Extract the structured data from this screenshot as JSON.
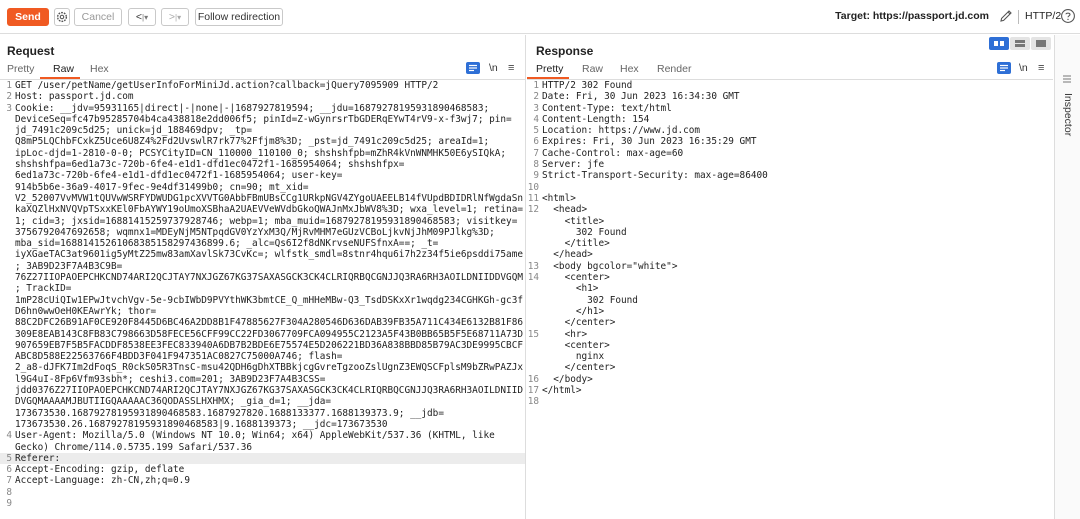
{
  "toolbar": {
    "send_label": "Send",
    "cancel_label": "Cancel",
    "back_label": "<",
    "back_drop": "|▾",
    "fwd_label": ">",
    "fwd_drop": "|▾",
    "follow_label": "Follow redirection",
    "target_text": "Target: https://passport.jd.com",
    "protocol": "HTTP/2"
  },
  "request": {
    "title": "Request",
    "tabs": [
      "Pretty",
      "Raw",
      "Hex"
    ],
    "active_tab": "Raw",
    "newline_label": "\\n",
    "lines": [
      {
        "n": "1",
        "t": "GET /user/petName/getUserInfoForMiniJd.action?callback=jQuery7095909 HTTP/2"
      },
      {
        "n": "2",
        "t": "Host: passport.jd.com"
      },
      {
        "n": "3",
        "t": "Cookie: __jdv=95931165|direct|-|none|-|1687927819594; __jdu=16879278195931890468583;"
      },
      {
        "n": "",
        "t": "DeviceSeq=fc47b95285704b4ca438818e2dd006f5; pinId=Z-wGynrsrTbGDERqEYwT4rV9-x-f3wj7; pin="
      },
      {
        "n": "",
        "t": "jd_7491c209c5d25; unick=jd_188469dpv; _tp="
      },
      {
        "n": "",
        "t": "Q8mP5LQChbFCxkZ5Uce6U8Z4%2Fd2UvswlR7rk77%2Ffjm8%3D; _pst=jd_7491c209c5d25; areaId=1;"
      },
      {
        "n": "",
        "t": "ipLoc-djd=1-2810-0-0; PCSYCityID=CN_110000_110100_0; shshshfpb=mZhR4kVnWNMHK50E6ySIQkA;"
      },
      {
        "n": "",
        "t": "shshshfpa=6ed1a73c-720b-6fe4-e1d1-dfd1ec0472f1-1685954064; shshshfpx="
      },
      {
        "n": "",
        "t": "6ed1a73c-720b-6fe4-e1d1-dfd1ec0472f1-1685954064; user-key="
      },
      {
        "n": "",
        "t": "914b5b6e-36a9-4017-9fec-9e4df31499b0; cn=90; mt_xid="
      },
      {
        "n": "",
        "t": "V2_52007VvMVW1tQUVwWSRFYDWUDG1pcXVVTG0AbbFBmUBsCCg1URkpNGV4ZYgoUAEELB14fVUpdBDIDRlNfWgdaSn"
      },
      {
        "n": "",
        "t": "kaXQZlHxNVQVpTSxxKEl0FbAYWY19oUmoXSBhaA2UAEVVeWVdbGkoQWAJnMxJbWV8%3D; wxa_level=1; retina="
      },
      {
        "n": "",
        "t": "1; cid=3; jxsid=16881415259737928746; webp=1; mba_muid=16879278195931890468583; visitkey="
      },
      {
        "n": "",
        "t": "3756792047692658; wqmnx1=MDEyNjM5NTpqdGV0YzYxM3Q/MjRvMHM7eGUzVCBoLjkvNjJhM09PJlkg%3D;"
      },
      {
        "n": "",
        "t": "mba_sid=16881415261068385158297436899.6; _alc=Qs6I2f8dNKrvseNUFSfnxA==; _t="
      },
      {
        "n": "",
        "t": "iyXGaeTAC3at9601ig5yMtZ25mw83amXavlSk73CvKc=; wlfstk_smdl=8stnr4hqu6i7h2z34f5ie6psddi75ame"
      },
      {
        "n": "",
        "t": "; 3AB9D23F7A4B3C9B="
      },
      {
        "n": "",
        "t": "76Z27IIOPAOEPCHKCND74ARI2QCJTAY7NXJGZ67KG37SAXASGCK3CK4CLRIQRBQCGNJJQ3RA6RH3AOILDNIIDDVGQM"
      },
      {
        "n": "",
        "t": "; TrackID="
      },
      {
        "n": "",
        "t": "1mP28cUiQIw1EPwJtvchVgv-5e-9cbIWbD9PVYthWK3bmtCE_Q_mHHeMBw-Q3_TsdDSKxXr1wqdg234CGHKGh-gc3f"
      },
      {
        "n": "",
        "t": "D6hn0wwOeH0KEAwrYk; thor="
      },
      {
        "n": "",
        "t": "88C2DFC26B91AF0CE920F8445D6BC46A2DD8B1F47885627F304A280546D636DAB39FB35A711C434E6132B81F86"
      },
      {
        "n": "",
        "t": "309E8EAB143C8FB83C798663D58FECE56CFF99CC22FD3067709FCA094955C2123A5F43B0BB65B5F5E68711A73D"
      },
      {
        "n": "",
        "t": "907659EB7F5B5FACDDF8538EE3FEC833940A6DB7B2BDE6E75574E5D206221BD36A838BBD85B79AC3DE9995CBCF"
      },
      {
        "n": "",
        "t": "ABC8D588E22563766F4BDD3F041F947351AC0827C75000A746; flash="
      },
      {
        "n": "",
        "t": "2_a8-dJFK7Im2dFoqS_R0ckS05R3TnsC-msu42QDH6gDhXTBBkjcgGvreTgzooZslUgnZ3EWQSCFplsM9bZRwPAZJx"
      },
      {
        "n": "",
        "t": "l9G4uI-8Fp6Vfm93sbh*; ceshi3.com=201; 3AB9D23F7A4B3CSS="
      },
      {
        "n": "",
        "t": "jdd0376Z27IIOPAOEPCHKCND74ARI2QCJTAY7NXJGZ67KG37SAXASGCK3CK4CLRIQRBQCGNJJQ3RA6RH3AOILDNIID"
      },
      {
        "n": "",
        "t": "DVGQMAAAAMJBUTIIGQAAAAAC36QODASSLHXHMX; _gia_d=1; __jda="
      },
      {
        "n": "",
        "t": "173673530.16879278195931890468583.1687927820.1688133377.1688139373.9; __jdb="
      },
      {
        "n": "",
        "t": "173673530.26.16879278195931890468583|9.1688139373; __jdc=173673530"
      },
      {
        "n": "4",
        "t": "User-Agent: Mozilla/5.0 (Windows NT 10.0; Win64; x64) AppleWebKit/537.36 (KHTML, like"
      },
      {
        "n": "",
        "t": "Gecko) Chrome/114.0.5735.199 Safari/537.36"
      },
      {
        "n": "5",
        "t": "Referer:"
      },
      {
        "n": "6",
        "t": "Accept-Encoding: gzip, deflate"
      },
      {
        "n": "7",
        "t": "Accept-Language: zh-CN,zh;q=0.9"
      },
      {
        "n": "8",
        "t": ""
      },
      {
        "n": "9",
        "t": ""
      }
    ]
  },
  "response": {
    "title": "Response",
    "tabs": [
      "Pretty",
      "Raw",
      "Hex",
      "Render"
    ],
    "active_tab": "Pretty",
    "newline_label": "\\n",
    "lines": [
      {
        "n": "1",
        "t": "HTTP/2 302 Found"
      },
      {
        "n": "2",
        "t": "Date: Fri, 30 Jun 2023 16:34:30 GMT"
      },
      {
        "n": "3",
        "t": "Content-Type: text/html"
      },
      {
        "n": "4",
        "t": "Content-Length: 154"
      },
      {
        "n": "5",
        "t": "Location: https://www.jd.com"
      },
      {
        "n": "6",
        "t": "Expires: Fri, 30 Jun 2023 16:35:29 GMT"
      },
      {
        "n": "7",
        "t": "Cache-Control: max-age=60"
      },
      {
        "n": "8",
        "t": "Server: jfe"
      },
      {
        "n": "9",
        "t": "Strict-Transport-Security: max-age=86400"
      },
      {
        "n": "10",
        "t": ""
      },
      {
        "n": "11",
        "t": "<html>"
      },
      {
        "n": "12",
        "t": "  <head>"
      },
      {
        "n": "",
        "t": "    <title>"
      },
      {
        "n": "",
        "t": "      302 Found"
      },
      {
        "n": "",
        "t": "    </title>"
      },
      {
        "n": "",
        "t": "  </head>"
      },
      {
        "n": "13",
        "t": "  <body bgcolor=\"white\">"
      },
      {
        "n": "14",
        "t": "    <center>"
      },
      {
        "n": "",
        "t": "      <h1>"
      },
      {
        "n": "",
        "t": "        302 Found"
      },
      {
        "n": "",
        "t": "      </h1>"
      },
      {
        "n": "",
        "t": "    </center>"
      },
      {
        "n": "15",
        "t": "    <hr>"
      },
      {
        "n": "",
        "t": "    <center>"
      },
      {
        "n": "",
        "t": "      nginx"
      },
      {
        "n": "",
        "t": "    </center>"
      },
      {
        "n": "16",
        "t": "  </body>"
      },
      {
        "n": "17",
        "t": "</html>"
      },
      {
        "n": "18",
        "t": ""
      }
    ]
  },
  "inspector": {
    "label": "Inspector"
  }
}
